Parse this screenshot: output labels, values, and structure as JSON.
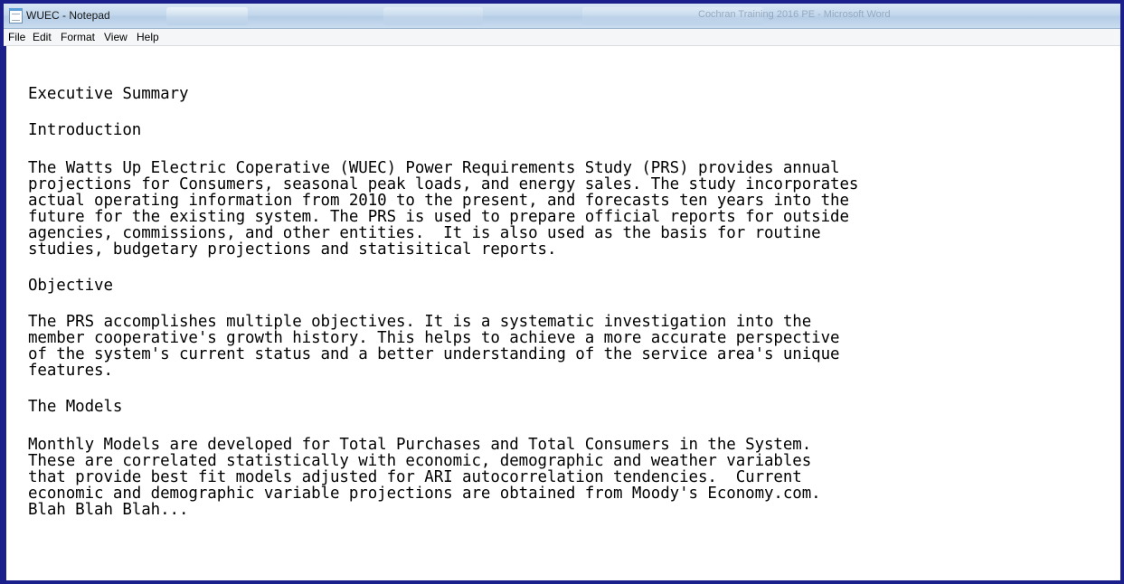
{
  "window": {
    "title": "WUEC - Notepad",
    "background_title": "Cochran Training 2016 PE - Microsoft Word"
  },
  "menu": {
    "items": [
      {
        "label": "File"
      },
      {
        "label": "Edit"
      },
      {
        "label": "Format"
      },
      {
        "label": "View"
      },
      {
        "label": "Help"
      }
    ]
  },
  "document": {
    "lines": [
      "Executive Summary",
      "",
      "Introduction",
      "",
      "The Watts Up Electric Coperative (WUEC) Power Requirements Study (PRS) provides annual",
      "projections for Consumers, seasonal peak loads, and energy sales. The study incorporates",
      "actual operating information from 2010 to the present, and forecasts ten years into the",
      "future for the existing system. The PRS is used to prepare official reports for outside",
      "agencies, commissions, and other entities.  It is also used as the basis for routine",
      "studies, budgetary projections and statisitical reports.",
      "",
      "Objective",
      "",
      "The PRS accomplishes multiple objectives. It is a systematic investigation into the",
      "member cooperative's growth history. This helps to achieve a more accurate perspective",
      "of the system's current status and a better understanding of the service area's unique",
      "features.",
      "",
      "The Models",
      "",
      "Monthly Models are developed for Total Purchases and Total Consumers in the System.",
      "These are correlated statistically with economic, demographic and weather variables",
      "that provide best fit models adjusted for ARI autocorrelation tendencies.  Current",
      "economic and demographic variable projections are obtained from Moody's Economy.com.",
      "Blah Blah Blah..."
    ]
  }
}
